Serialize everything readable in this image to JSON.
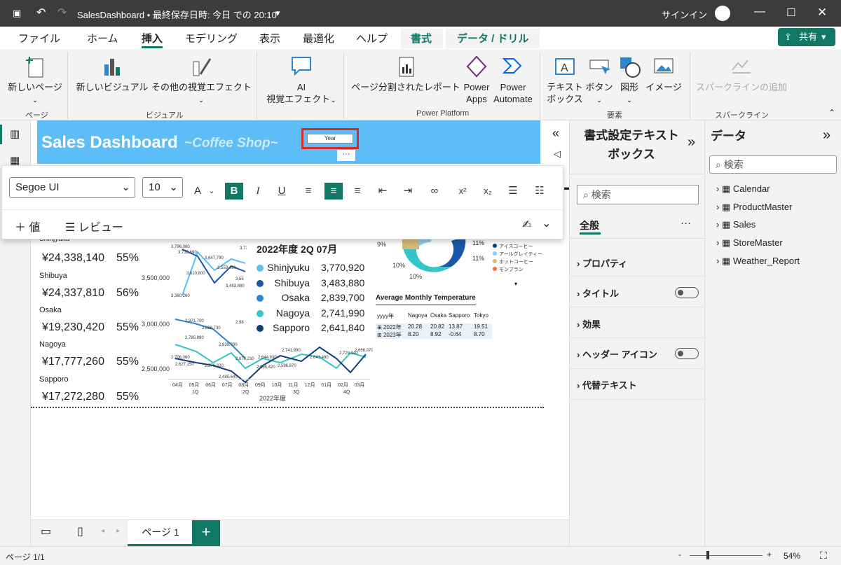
{
  "window": {
    "title": "SalesDashboard • 最終保存日時: 今日 での 20:10",
    "signin": "サインイン"
  },
  "tabs": [
    "ファイル",
    "ホーム",
    "挿入",
    "モデリング",
    "表示",
    "最適化",
    "ヘルプ",
    "書式",
    "データ / ドリル"
  ],
  "share": "共有",
  "ribbon": {
    "new_page": "新しいページ",
    "new_visual": "新しいビジュアル",
    "other_visuals": "その他の視覚エフェクト",
    "ai_line1": "AI",
    "ai_line2": "視覚エフェクト",
    "paginated": "ページ分割されたレポート",
    "power_apps": [
      "Power",
      "Apps"
    ],
    "power_automate": [
      "Power",
      "Automate"
    ],
    "textbox": [
      "テキスト",
      "ボックス"
    ],
    "button": "ボタン",
    "shape": "図形",
    "image": "イメージ",
    "sparkline": "スパークラインの追加",
    "groups": {
      "page": "ページ",
      "visual": "ビジュアル",
      "power_platform": "Power Platform",
      "elements": "要素",
      "sparkline": "スパークライン"
    }
  },
  "banner": {
    "title": "Sales Dashboard",
    "subtitle": "~Coffee Shop~",
    "slicer_label": "Year"
  },
  "format_bar": {
    "font": "Segoe UI",
    "size": "10",
    "add_value": "値",
    "review": "レビュー"
  },
  "cards": [
    {
      "store": "Shinjyuku",
      "amount": "¥24,338,140",
      "pct": "55%"
    },
    {
      "store": "Shibuya",
      "amount": "¥24,337,810",
      "pct": "56%"
    },
    {
      "store": "Osaka",
      "amount": "¥19,230,420",
      "pct": "55%"
    },
    {
      "store": "Nagoya",
      "amount": "¥17,777,260",
      "pct": "55%"
    },
    {
      "store": "Sapporo",
      "amount": "¥17,272,280",
      "pct": "55%"
    }
  ],
  "tooltip": {
    "title": "2022年度 2Q 07月",
    "rows": [
      {
        "name": "Shinjyuku",
        "value": "3,770,920",
        "color": "#5cbdf7"
      },
      {
        "name": "Shibuya",
        "value": "3,483,880",
        "color": "#1a57a6"
      },
      {
        "name": "Osaka",
        "value": "2,839,700",
        "color": "#2f86d0"
      },
      {
        "name": "Nagoya",
        "value": "2,741,990",
        "color": "#33c6c8"
      },
      {
        "name": "Sapporo",
        "value": "2,641,840",
        "color": "#123f7a"
      }
    ]
  },
  "chart_data": [
    {
      "type": "line",
      "x": [
        "04月",
        "05月",
        "06月",
        "07月",
        "08月",
        "09月",
        "10月",
        "11月",
        "12月",
        "01月",
        "02月",
        "03月"
      ],
      "quarters": [
        "1Q",
        "2Q",
        "3Q",
        "4Q"
      ],
      "xlabel": "2022年度",
      "yticks": [
        "3,500,000",
        "3,000,000",
        "2,500,000"
      ],
      "labels_top": [
        "3,796,060",
        "3,732,690",
        "3,647,790",
        "3,770,920",
        "3,610,800",
        "3,559,490",
        "3,483,880",
        "3,55",
        "3,360,260"
      ],
      "labels_mid": [
        "2,971,700",
        "2,888,730",
        "2,785,890",
        "2,98",
        "2,839,700",
        "2,706,060",
        "2,676,230",
        "2,627,150",
        "2,576,320",
        "2,644,930",
        "2,741,990",
        "2,485,640",
        "2,565,420",
        "2,774,640",
        "2,596,870",
        "2,641,480",
        "2,729,340",
        "2,666,070"
      ],
      "series": [
        {
          "name": "Shinjyuku",
          "values": [
            3360260,
            3796060,
            3610800,
            3770920,
            3559490
          ]
        },
        {
          "name": "Shibuya",
          "values": [
            3732690,
            3647790,
            3483880,
            3550000
          ]
        }
      ]
    },
    {
      "type": "pie",
      "legend": [
        "アイスコーヒー",
        "アールグレイティー",
        "ホットコーヒー",
        "モンブラン"
      ],
      "labels": [
        "9%",
        "10%",
        "10%",
        "11%",
        "11%"
      ]
    },
    {
      "type": "table",
      "title": "Average Monthly Temperature",
      "columns": [
        "yyyy年",
        "Nagoya",
        "Osaka",
        "Sapporo",
        "Tokyo"
      ],
      "rows": [
        [
          "2022年",
          "20.28",
          "20.82",
          "13.87",
          "19.51"
        ],
        [
          "2023年",
          "8.20",
          "8.92",
          "-0.64",
          "8.70"
        ]
      ]
    }
  ],
  "format_pane": {
    "title_l1": "書式設定テキスト",
    "title_l2": "ボックス",
    "search": "検索",
    "general": "全般",
    "sections": [
      "プロパティ",
      "タイトル",
      "効果",
      "ヘッダー アイコン",
      "代替テキスト"
    ]
  },
  "data_pane": {
    "title": "データ",
    "search": "検索",
    "tables": [
      "Calendar",
      "ProductMaster",
      "Sales",
      "StoreMaster",
      "Weather_Report"
    ]
  },
  "page_tab": "ページ 1",
  "status": {
    "page": "ページ 1/1",
    "zoom": "54%"
  }
}
